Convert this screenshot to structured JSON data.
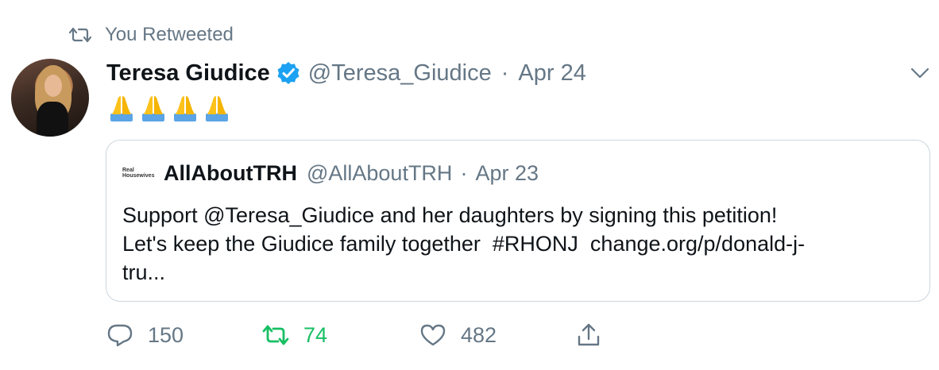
{
  "retweet_context": {
    "label": "You Retweeted"
  },
  "tweet": {
    "author_name": "Teresa Giudice",
    "handle": "@Teresa_Giudice",
    "separator": "·",
    "date": "Apr 24",
    "text_emojis": "🙏🙏🙏🙏"
  },
  "quoted_tweet": {
    "logo_text": [
      "Real",
      "Housewives"
    ],
    "author_name": "AllAboutTRH",
    "handle": "@AllAboutTRH",
    "separator": "·",
    "date": "Apr 23",
    "line1": "Support @Teresa_Giudice and her daughters by signing this petition!",
    "line2": "Let's keep the Giudice family together  #RHONJ  change.org/p/donald-j-",
    "line3": "tru..."
  },
  "actions": {
    "replies": "150",
    "retweets": "74",
    "likes": "482"
  },
  "colors": {
    "muted": "#657786",
    "retweet_green": "#17bf63",
    "verified_blue": "#1da1f2",
    "border": "#ccd6dd"
  }
}
